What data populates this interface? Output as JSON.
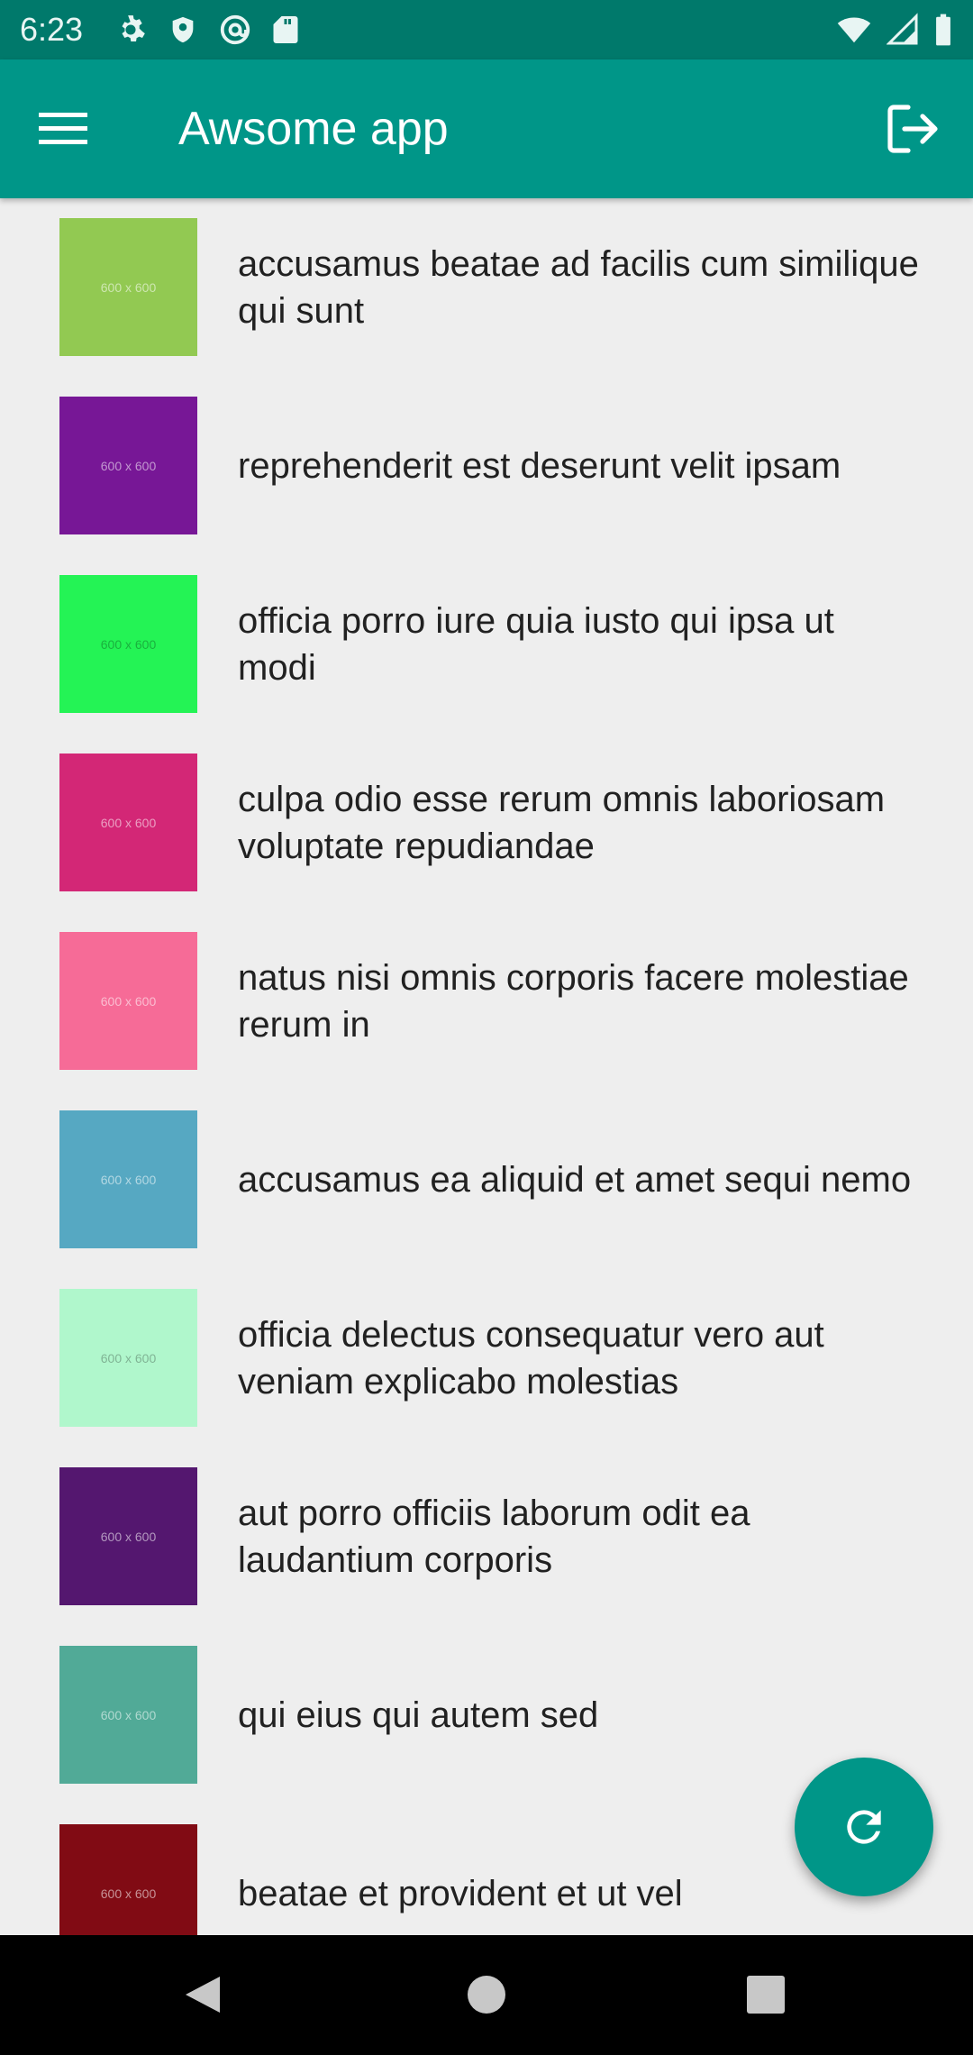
{
  "status_bar": {
    "time": "6:23",
    "left_icons": [
      "settings-icon",
      "shield-icon",
      "at-sign-icon",
      "sd-card-icon"
    ],
    "right_icons": [
      "wifi-icon",
      "cell-signal-icon",
      "battery-icon"
    ]
  },
  "app_bar": {
    "title": "Awsome app",
    "menu_icon": "hamburger-menu-icon",
    "logout_icon": "logout-icon",
    "color": "#009688"
  },
  "list": {
    "thumbnail_label": "600 x 600",
    "items": [
      {
        "title": "accusamus beatae ad facilis cum similique qui sunt",
        "color": "#92c952"
      },
      {
        "title": "reprehenderit est deserunt velit ipsam",
        "color": "#771796"
      },
      {
        "title": "officia porro iure quia iusto qui ipsa ut modi",
        "color": "#24f355"
      },
      {
        "title": "culpa odio esse rerum omnis laboriosam voluptate repudiandae",
        "color": "#d32776"
      },
      {
        "title": "natus nisi omnis corporis facere molestiae rerum in",
        "color": "#f66b97"
      },
      {
        "title": "accusamus ea aliquid et amet sequi nemo",
        "color": "#56a8c2"
      },
      {
        "title": "officia delectus consequatur vero aut veniam explicabo molestias",
        "color": "#b0f7cc"
      },
      {
        "title": "aut porro officiis laborum odit ea laudantium corporis",
        "color": "#54176f"
      },
      {
        "title": "qui eius qui autem sed",
        "color": "#51aa97"
      },
      {
        "title": "beatae et provident et ut vel",
        "color": "#810b14"
      }
    ]
  },
  "fab": {
    "icon": "refresh-icon",
    "color": "#009688"
  },
  "nav_bar": {
    "icons": [
      "back-triangle-icon",
      "home-circle-icon",
      "recents-square-icon"
    ]
  }
}
